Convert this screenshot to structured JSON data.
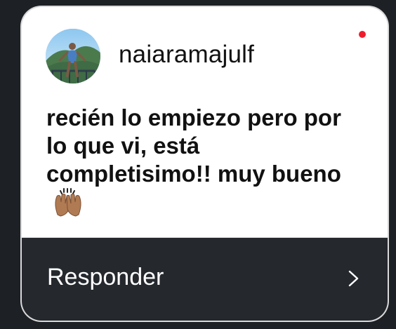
{
  "profile": {
    "username": "naiaramajulf"
  },
  "message": {
    "text": "recién lo empiezo pero por lo que vi, está completisimo!! muy bueno"
  },
  "footer": {
    "reply_label": "Responder"
  },
  "icons": {
    "unread": "unread-dot-icon",
    "hands": "raising-hands-icon",
    "next": "chevron-right-icon"
  },
  "colors": {
    "background": "#1d2024",
    "card": "#ffffff",
    "footer": "#25292e",
    "accent": "#ee1d2e",
    "text": "#111111"
  }
}
